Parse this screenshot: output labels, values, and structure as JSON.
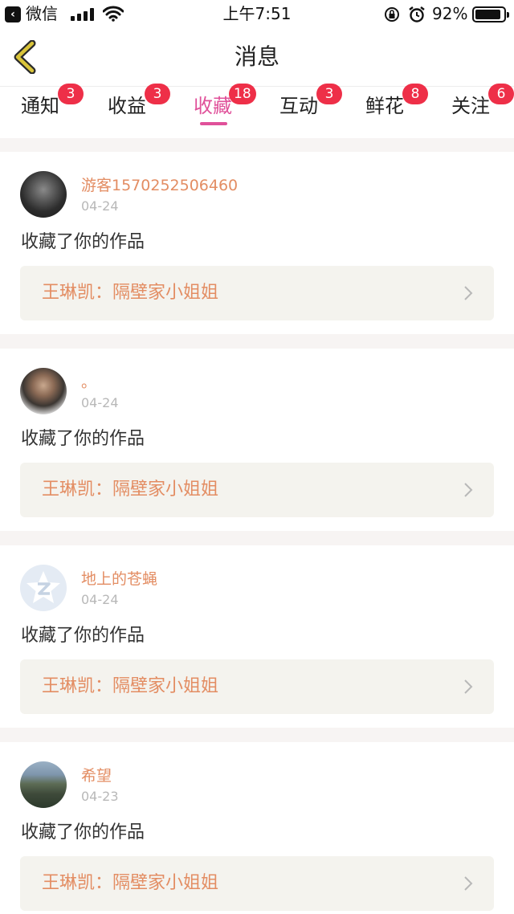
{
  "status_bar": {
    "back_app": "微信",
    "time": "上午7:51",
    "battery": "92%",
    "battery_level": 0.92
  },
  "nav": {
    "title": "消息"
  },
  "tabs": [
    {
      "label": "通知",
      "badge": "3",
      "active": false
    },
    {
      "label": "收益",
      "badge": "3",
      "active": false
    },
    {
      "label": "收藏",
      "badge": "18",
      "active": true
    },
    {
      "label": "互动",
      "badge": "3",
      "active": false
    },
    {
      "label": "鲜花",
      "badge": "8",
      "active": false
    },
    {
      "label": "关注",
      "badge": "6",
      "active": false
    }
  ],
  "messages": [
    {
      "username": "游客1570252506460",
      "date": "04-24",
      "action": "收藏了你的作品",
      "work": "王琳凯：隔壁家小姐姐",
      "avatar": "avatar-photo-dark"
    },
    {
      "username": "。",
      "date": "04-24",
      "action": "收藏了你的作品",
      "work": "王琳凯：隔壁家小姐姐",
      "avatar": "avatar-photo-man"
    },
    {
      "username": "地上的苍蝇",
      "date": "04-24",
      "action": "收藏了你的作品",
      "work": "王琳凯：隔壁家小姐姐",
      "avatar": "qzone-default-avatar"
    },
    {
      "username": "希望",
      "date": "04-23",
      "action": "收藏了你的作品",
      "work": "王琳凯：隔壁家小姐姐",
      "avatar": "avatar-photo-landscape"
    }
  ],
  "colors": {
    "accent": "#e0519a",
    "badge": "#ee2f48",
    "username": "#e38d63",
    "back_arrow": "#d9c43a"
  }
}
